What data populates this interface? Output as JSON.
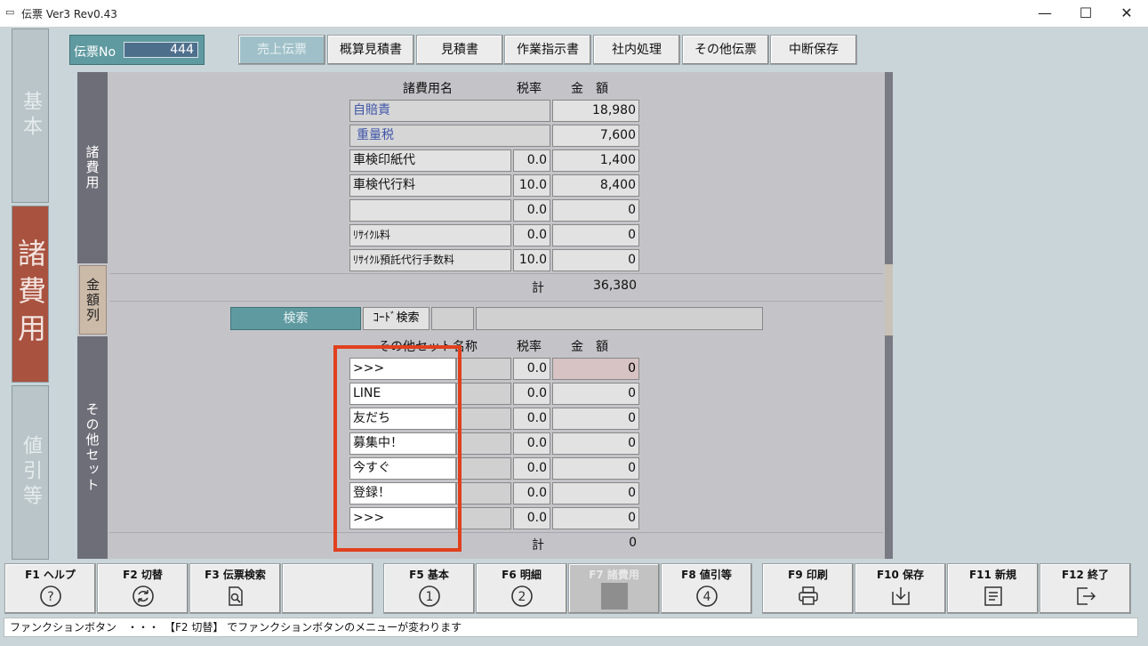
{
  "window": {
    "title": "伝票 Ver3 Rev0.43",
    "minimize": "—",
    "maximize": "☐",
    "close": "✕"
  },
  "nav": {
    "kihon": "基本",
    "shohiyo": "諸費用",
    "nebiki": "値引等"
  },
  "header": {
    "denpyo_label": "伝票No",
    "denpyo_no": "444",
    "tabs": [
      {
        "label": "売上伝票",
        "active": true
      },
      {
        "label": "概算見積書"
      },
      {
        "label": "見積書"
      },
      {
        "label": "作業指示書"
      },
      {
        "label": "社内処理"
      },
      {
        "label": "その他伝票"
      },
      {
        "label": "中断保存"
      }
    ]
  },
  "sections": {
    "shohiyo": "諸費用",
    "kingaku": "金額列",
    "sonota": "その他セット"
  },
  "fees": {
    "col_name": "諸費用名",
    "col_rate": "税率",
    "col_amount": "金　額",
    "rows": [
      {
        "name": "自賠責",
        "rate": "",
        "amount": "18,980",
        "blue": true
      },
      {
        "name": "重量税",
        "rate": "",
        "amount": "7,600",
        "blue": true
      },
      {
        "name": "車検印紙代",
        "rate": "0.0",
        "amount": "1,400"
      },
      {
        "name": "車検代行料",
        "rate": "10.0",
        "amount": "8,400"
      },
      {
        "name": "",
        "rate": "0.0",
        "amount": "0"
      },
      {
        "name": "ﾘｻｲｸﾙ料",
        "rate": "0.0",
        "amount": "0"
      },
      {
        "name": "ﾘｻｲｸﾙ預託代行手数料",
        "rate": "10.0",
        "amount": "0"
      }
    ],
    "total_label": "計",
    "total": "36,380"
  },
  "search": {
    "button": "検索",
    "code_label": "ｺｰﾄﾞ検索",
    "code_value": "",
    "name_value": ""
  },
  "sets": {
    "col_name": "その他セット名称",
    "col_rate": "税率",
    "col_amount": "金　額",
    "rows": [
      {
        "name": ">>>",
        "rate": "0.0",
        "amount": "0"
      },
      {
        "name": "LINE",
        "rate": "0.0",
        "amount": "0"
      },
      {
        "name": "友だち",
        "rate": "0.0",
        "amount": "0"
      },
      {
        "name": "募集中！",
        "rate": "0.0",
        "amount": "0"
      },
      {
        "name": "今すぐ",
        "rate": "0.0",
        "amount": "0"
      },
      {
        "name": "登録！",
        "rate": "0.0",
        "amount": "0"
      },
      {
        "name": ">>>",
        "rate": "0.0",
        "amount": "0"
      }
    ],
    "total_label": "計",
    "total": "0"
  },
  "fkeys": [
    {
      "label": "F1 ヘルプ",
      "icon": "help-icon",
      "glyph": "?"
    },
    {
      "label": "F2 切替",
      "icon": "switch-icon",
      "glyph": "⟳"
    },
    {
      "label": "F3 伝票検索",
      "icon": "search-doc-icon",
      "glyph": ""
    },
    {
      "label": "",
      "icon": "",
      "glyph": ""
    },
    {
      "label": "F5 基本",
      "icon": "circle-1-icon",
      "glyph": "1"
    },
    {
      "label": "F6 明細",
      "icon": "circle-2-icon",
      "glyph": "2"
    },
    {
      "label": "F7 諸費用",
      "icon": "disabled-icon",
      "glyph": "",
      "disabled": true
    },
    {
      "label": "F8 値引等",
      "icon": "circle-4-icon",
      "glyph": "4"
    },
    {
      "label": "F9 印刷",
      "icon": "printer-icon",
      "glyph": ""
    },
    {
      "label": "F10 保存",
      "icon": "save-icon",
      "glyph": ""
    },
    {
      "label": "F11 新規",
      "icon": "new-doc-icon",
      "glyph": ""
    },
    {
      "label": "F12 終了",
      "icon": "exit-icon",
      "glyph": ""
    }
  ],
  "status": "ファンクションボタン　・・・　【F2 切替】 でファンクションボタンのメニューが変わります",
  "colors": {
    "accent": "#5f9aa0",
    "nav_active": "#a9523f",
    "highlight_box": "#e0401e"
  }
}
